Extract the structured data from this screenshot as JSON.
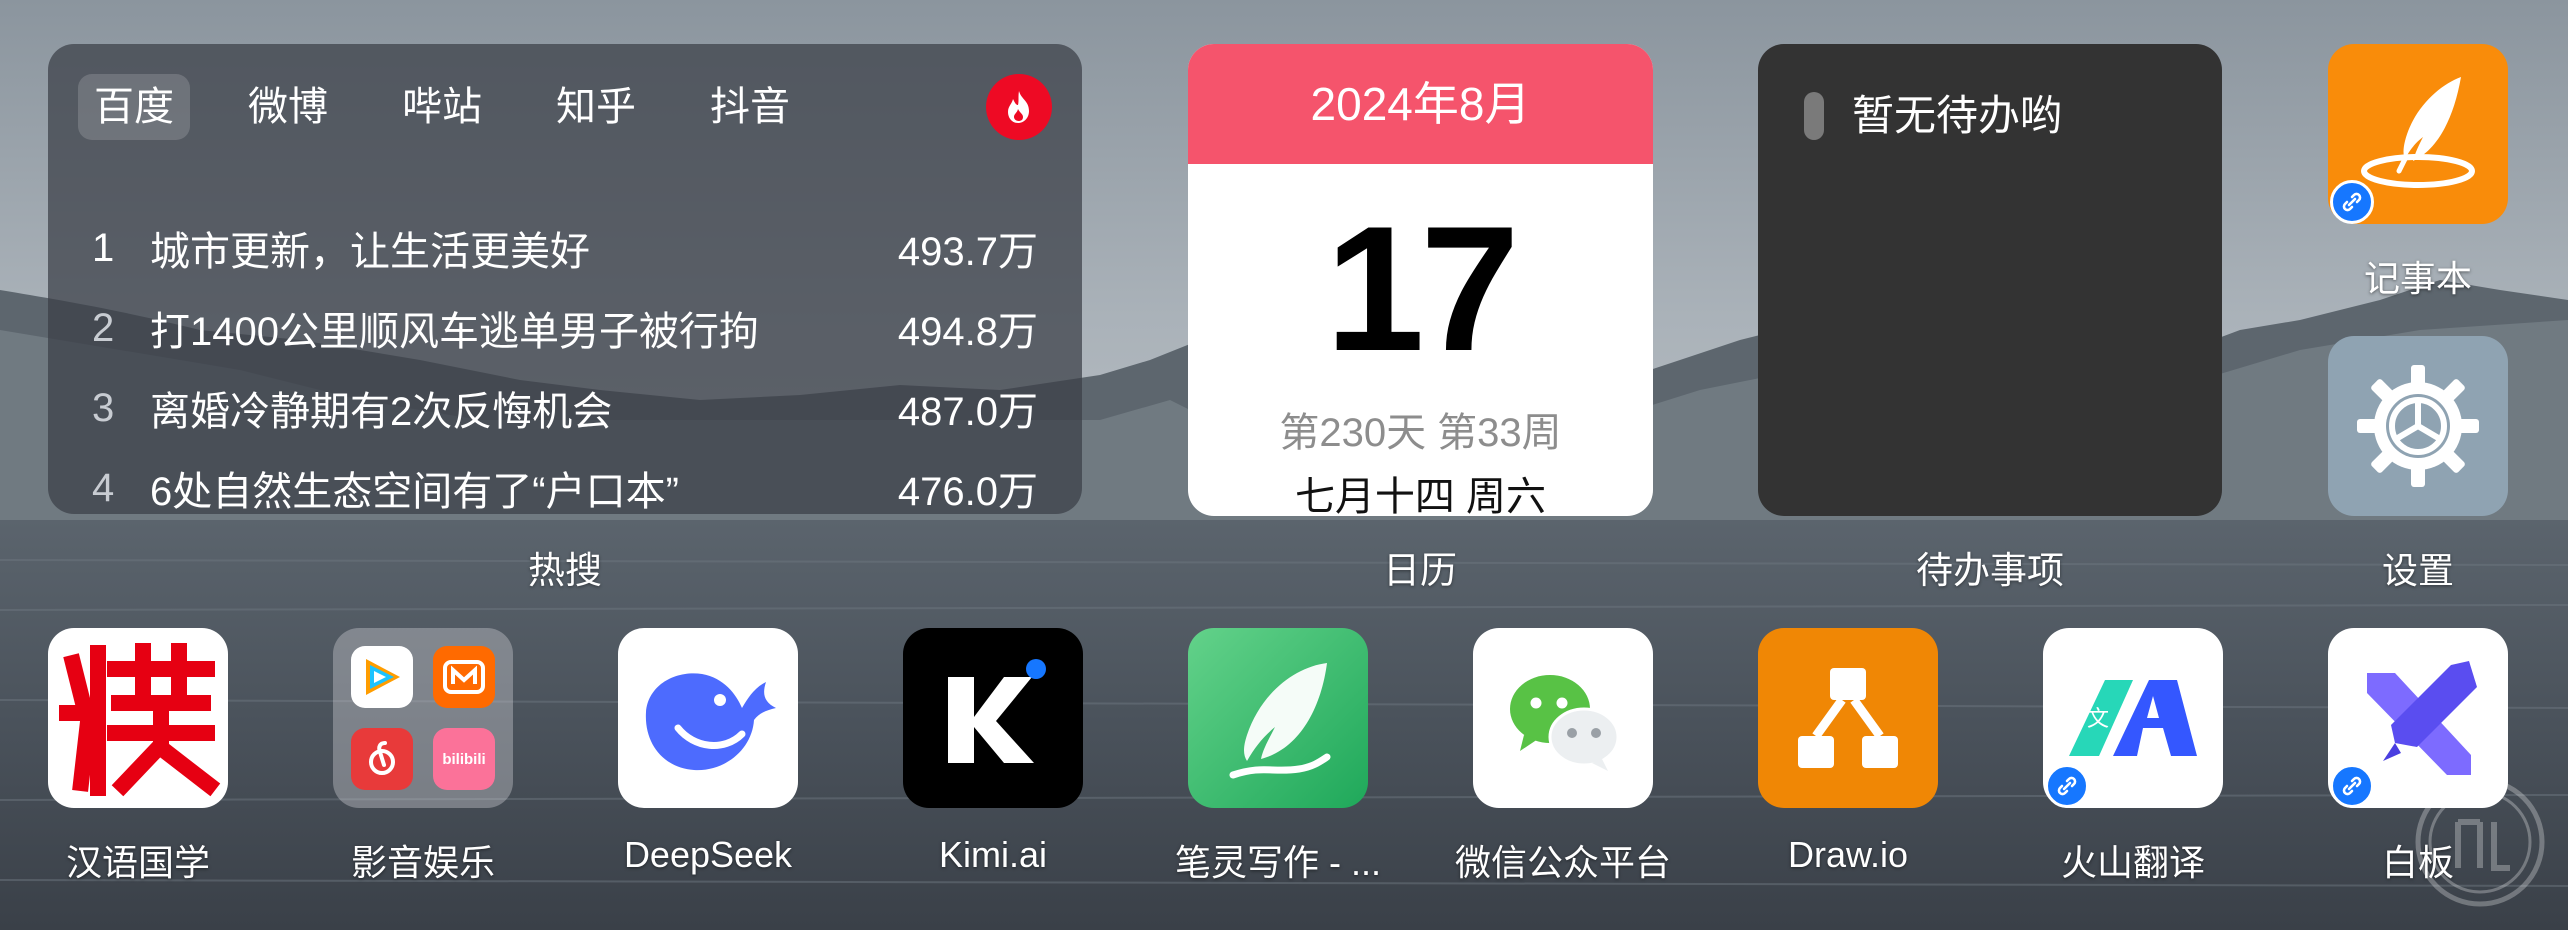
{
  "hot_search": {
    "tabs": [
      "百度",
      "微博",
      "哔站",
      "知乎",
      "抖音"
    ],
    "active_tab": 0,
    "items": [
      {
        "rank": "1",
        "title": "城市更新，让生活更美好",
        "count": "493.7万"
      },
      {
        "rank": "2",
        "title": "打1400公里顺风车逃单男子被行拘",
        "count": "494.8万"
      },
      {
        "rank": "3",
        "title": "离婚冷静期有2次反悔机会",
        "count": "487.0万"
      },
      {
        "rank": "4",
        "title": "6处自然生态空间有了“户口本”",
        "count": "476.0万"
      }
    ],
    "label": "热搜",
    "fire_icon": "fire-icon"
  },
  "calendar": {
    "month": "2024年8月",
    "day": "17",
    "info": "第230天 第33周",
    "lunar": "七月十四 周六",
    "label": "日历",
    "header_color": "#f5546c"
  },
  "todo": {
    "empty_text": "暂无待办哟",
    "label": "待办事项"
  },
  "side_apps": [
    {
      "name": "记事本",
      "icon": "quill-icon",
      "color": "#f98c0a"
    },
    {
      "name": "设置",
      "icon": "gear-icon",
      "color": "#8fa3b2"
    }
  ],
  "dock_apps": [
    {
      "name": "汉语国学",
      "icon": "hanyu-guoxue-icon"
    },
    {
      "name": "影音娱乐",
      "icon": "media-folder-icon"
    },
    {
      "name": "DeepSeek",
      "icon": "whale-icon"
    },
    {
      "name": "Kimi.ai",
      "icon": "kimi-k-icon"
    },
    {
      "name": "笔灵写作 - ...",
      "icon": "feather-icon"
    },
    {
      "name": "微信公众平台",
      "icon": "wechat-icon"
    },
    {
      "name": "Draw.io",
      "icon": "diagram-icon"
    },
    {
      "name": "火山翻译",
      "icon": "translate-icon"
    },
    {
      "name": "白板",
      "icon": "whiteboard-icon"
    }
  ]
}
